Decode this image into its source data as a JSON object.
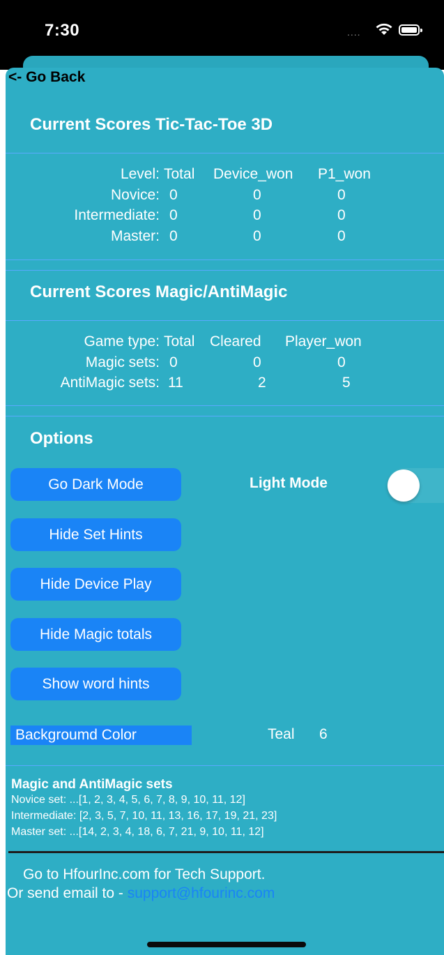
{
  "status_bar": {
    "time": "7:30",
    "signal": "....",
    "wifi_icon": "wifi-icon",
    "battery_icon": "battery-icon"
  },
  "nav": {
    "back_label": "<- Go Back"
  },
  "tictactoe": {
    "title": "Current Scores Tic-Tac-Toe 3D",
    "headers": [
      "Level:",
      "Total",
      "Device_won",
      "P1_won"
    ],
    "rows": [
      {
        "label": "Novice:",
        "total": "0",
        "device_won": "0",
        "p1_won": "0"
      },
      {
        "label": "Intermediate:",
        "total": "0",
        "device_won": "0",
        "p1_won": "0"
      },
      {
        "label": "Master:",
        "total": "0",
        "device_won": "0",
        "p1_won": "0"
      }
    ]
  },
  "magic": {
    "title": "Current Scores Magic/AntiMagic",
    "headers": [
      "Game type:",
      "Total",
      "Cleared",
      "Player_won"
    ],
    "rows": [
      {
        "label": "Magic sets:",
        "total": "0",
        "cleared": "0",
        "player_won": "0"
      },
      {
        "label": "AntiMagic sets:",
        "total": "11",
        "cleared": "2",
        "player_won": "5"
      }
    ]
  },
  "options": {
    "title": "Options",
    "buttons": [
      "Go Dark Mode",
      "Hide Set Hints",
      "Hide Device Play",
      "Hide Magic totals",
      "Show word hints"
    ],
    "mode_label": "Light Mode",
    "dark_mode_on": false,
    "background_color_label": "Backgroumd Color",
    "background_color_value": "Teal",
    "background_color_index": "6"
  },
  "sets": {
    "title": "Magic and AntiMagic sets",
    "novice": "Novice set: ...[1, 2, 3, 4, 5, 6, 7, 8, 9, 10, 11, 12]",
    "intermediate": "Intermediate: [2, 3, 5, 7, 10, 11, 13, 16, 17, 19, 21, 23]",
    "master": "Master set: ...[14, 2, 3, 4, 18, 6, 7, 21, 9, 10, 11, 12]"
  },
  "support": {
    "line1": "Go to HfourInc.com for Tech Support.",
    "line2_prefix": "Or send email to - ",
    "email": "support@hfourinc.com"
  },
  "colors": {
    "sheet": "#2eaec5",
    "button": "#1a84f6",
    "link": "#1a84f6",
    "divider": "#5aa9ff"
  }
}
